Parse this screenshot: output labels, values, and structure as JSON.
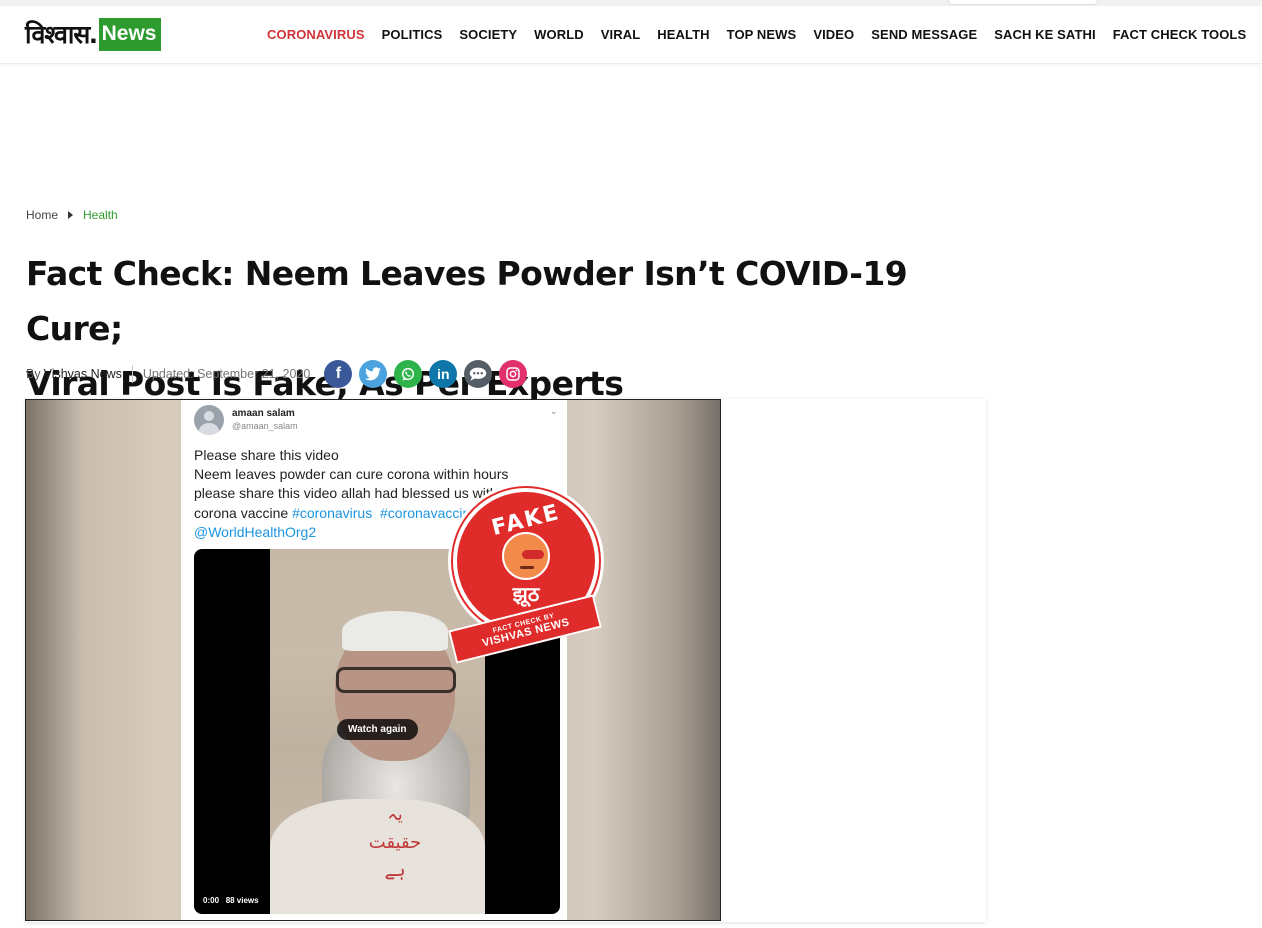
{
  "header": {
    "logo": {
      "hindi": "विश्वास",
      "dot": ".",
      "news": "News"
    },
    "nav": [
      {
        "label": "CORONAVIRUS",
        "active": true
      },
      {
        "label": "POLITICS"
      },
      {
        "label": "SOCIETY"
      },
      {
        "label": "WORLD"
      },
      {
        "label": "VIRAL"
      },
      {
        "label": "HEALTH"
      },
      {
        "label": "TOP NEWS"
      },
      {
        "label": "VIDEO"
      },
      {
        "label": "SEND MESSAGE"
      },
      {
        "label": "SACH KE SATHI"
      },
      {
        "label": "FACT CHECK TOOLS"
      }
    ],
    "accent_color": "#d13438",
    "brand_green": "#2e9b2e"
  },
  "breadcrumb": {
    "home": "Home",
    "category": "Health"
  },
  "article": {
    "title_line1": "Fact Check: Neem Leaves Powder Isn’t COVID-19 Cure;",
    "title_line2": "Viral Post Is Fake, As Per Experts",
    "by_prefix": "By",
    "author": "Vishvas News",
    "updated": "Updated: September 21, 2020",
    "share_icons": [
      "facebook-icon",
      "twitter-icon",
      "whatsapp-icon",
      "linkedin-icon",
      "message-icon",
      "instagram-icon"
    ]
  },
  "media": {
    "tweet": {
      "name": "amaan salam",
      "handle": "@amaan_salam",
      "line1": "Please share this video",
      "line2": "Neem leaves powder can cure corona within hours",
      "line3": "please share this video allah had blessed us with the",
      "line4_text": "corona vaccine ",
      "tag1": "#coronavirus",
      "tag2": "#coronavaccine",
      "tag3": "@WorldHealthOrg2"
    },
    "video": {
      "overlay_urdu_1": "یہ",
      "overlay_urdu_2": "حقیقت",
      "overlay_urdu_3": "ہے",
      "watch_again": "Watch again",
      "time": "0:00",
      "views": "88 views"
    },
    "badge": {
      "fake": "FAKE",
      "hindi": "झूठ",
      "ribbon_line1": "FACT CHECK BY",
      "ribbon_line2": "VISHVAS NEWS"
    }
  }
}
